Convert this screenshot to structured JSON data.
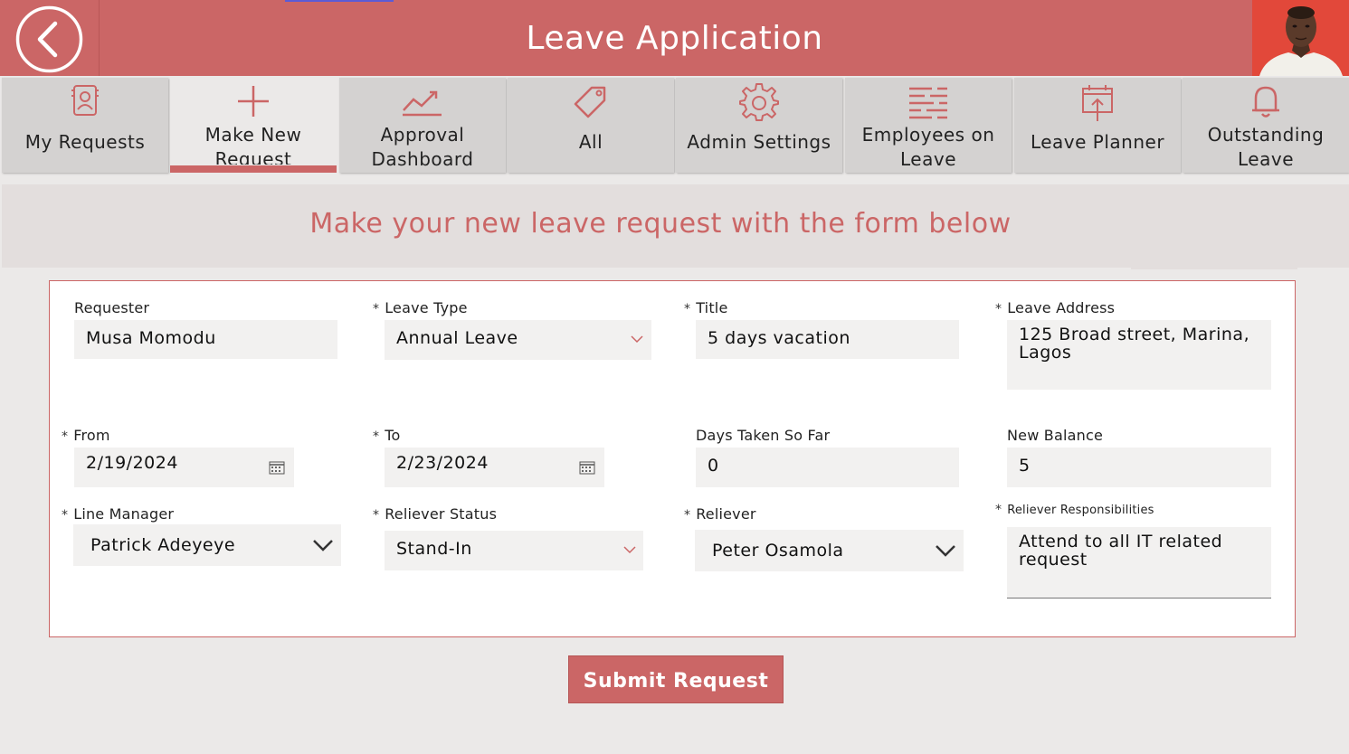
{
  "header": {
    "title": "Leave Application",
    "back_icon": "chevron-left-circle-icon",
    "avatar_alt": "user-avatar",
    "color": "#cb6666"
  },
  "nav": {
    "tabs": [
      {
        "label": "My Requests",
        "icon": "contact-card-icon",
        "active": false
      },
      {
        "label": "Make New Request",
        "icon": "plus-icon",
        "active": true
      },
      {
        "label": "Approval Dashboard",
        "icon": "trend-line-icon",
        "active": false
      },
      {
        "label": "All",
        "icon": "tag-icon",
        "active": false
      },
      {
        "label": "Admin Settings",
        "icon": "gear-icon",
        "active": false
      },
      {
        "label": "Employees on Leave",
        "icon": "list-icon",
        "active": false
      },
      {
        "label": "Leave Planner",
        "icon": "calendar-upload-icon",
        "active": false
      },
      {
        "label": "Outstanding Leave",
        "icon": "bell-icon",
        "active": false
      }
    ]
  },
  "banner": {
    "text": "Make your new leave request with the form below"
  },
  "form": {
    "required_marker": "*",
    "requester": {
      "label": "Requester",
      "value": "Musa Momodu"
    },
    "leave_type": {
      "label": "Leave Type",
      "value": "Annual Leave"
    },
    "title": {
      "label": "Title",
      "value": "5 days vacation"
    },
    "leave_address": {
      "label": "Leave Address",
      "value": "125 Broad street, Marina, Lagos"
    },
    "from": {
      "label": "From",
      "value": "2/19/2024"
    },
    "to": {
      "label": "To",
      "value": "2/23/2024"
    },
    "days_taken": {
      "label": "Days Taken So Far",
      "value": "0"
    },
    "new_balance": {
      "label": "New Balance",
      "value": "5"
    },
    "line_manager": {
      "label": "Line Manager",
      "value": "Patrick Adeyeye"
    },
    "reliever_status": {
      "label": "Reliever Status",
      "value": "Stand-In"
    },
    "reliever": {
      "label": "Reliever",
      "value": "Peter Osamola"
    },
    "reliever_responsibilities": {
      "label": "Reliever Responsibilities",
      "value": "Attend to all IT related request"
    }
  },
  "submit": {
    "label": "Submit Request"
  }
}
